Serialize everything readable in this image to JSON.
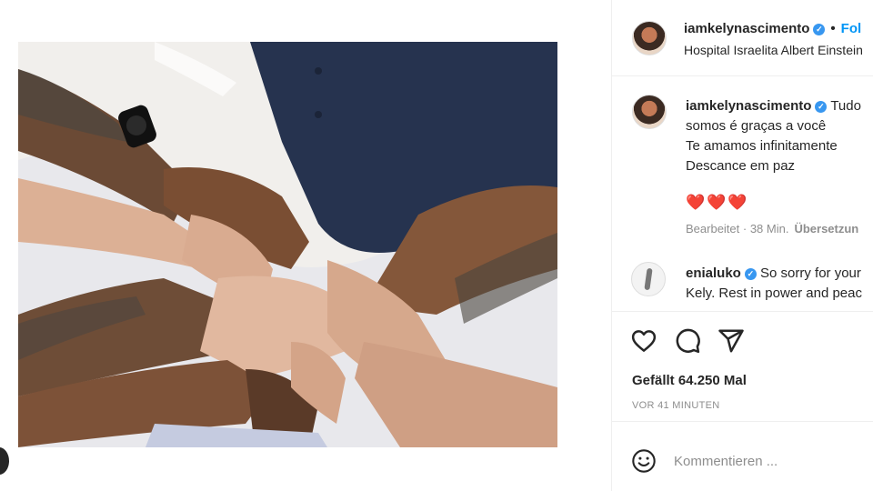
{
  "post": {
    "username": "iamkelynascimento",
    "follow_label": "Fol",
    "location": "Hospital Israelita Albert Einstein"
  },
  "caption": {
    "username": "iamkelynascimento",
    "line1_start": "Tudo",
    "line2": "somos é graças a você",
    "line3": "Te amamos infinitamente",
    "line4": "Descance em paz",
    "hearts": "❤️❤️❤️",
    "edited": "Bearbeitet · 38 Min.",
    "translate": "Übersetzun"
  },
  "comment": {
    "username": "enialuko",
    "text_line1": "So sorry for your",
    "text_line2": "Kely. Rest in power and peac"
  },
  "actions": {
    "likes": "Gefällt 64.250 Mal",
    "timestamp": "VOR 41 MINUTEN"
  },
  "comment_box": {
    "placeholder": "Kommentieren ..."
  },
  "icons": {
    "like": "heart-icon",
    "comment": "speech-bubble-icon",
    "share": "paper-plane-icon",
    "emoji": "smiley-icon",
    "verified": "verified-badge-icon"
  },
  "colors": {
    "verified": "#3897f0",
    "link": "#0095f6",
    "heart": "#e0245e",
    "muted": "#8e8e8e"
  }
}
